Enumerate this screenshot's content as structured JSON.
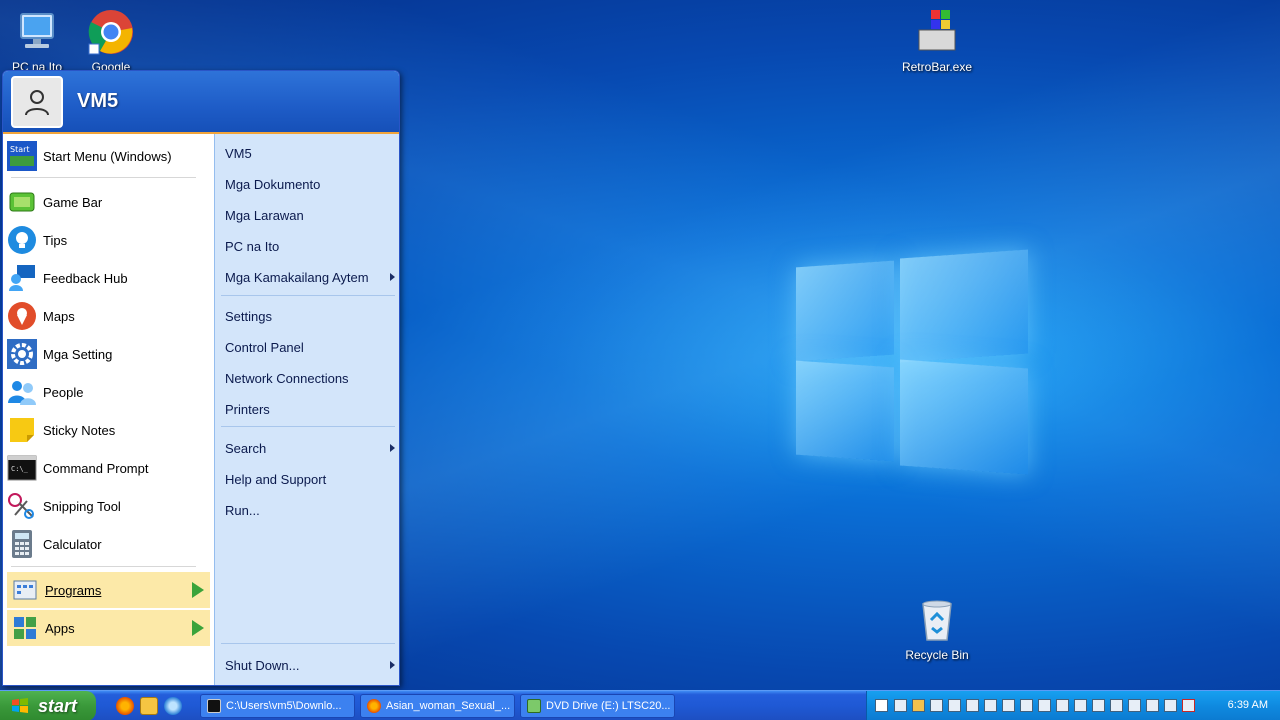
{
  "desktop": {
    "icons": [
      {
        "label": "PC na Ito",
        "icon": "computer-icon"
      },
      {
        "label": "Google",
        "icon": "chrome-icon"
      },
      {
        "label": "RetroBar.exe",
        "icon": "retrobar-icon"
      },
      {
        "label": "Recycle Bin",
        "icon": "recycle-bin-icon"
      }
    ]
  },
  "start_menu": {
    "user": "VM5",
    "left_items": [
      {
        "label": "Start Menu (Windows)",
        "icon": "start-menu-icon"
      },
      {
        "label": "Game Bar",
        "icon": "game-bar-icon"
      },
      {
        "label": "Tips",
        "icon": "tips-icon"
      },
      {
        "label": "Feedback Hub",
        "icon": "feedback-icon"
      },
      {
        "label": "Maps",
        "icon": "maps-icon"
      },
      {
        "label": "Mga Setting",
        "icon": "gear-icon"
      },
      {
        "label": "People",
        "icon": "people-icon"
      },
      {
        "label": "Sticky Notes",
        "icon": "sticky-notes-icon"
      },
      {
        "label": "Command Prompt",
        "icon": "cmd-icon"
      },
      {
        "label": "Snipping Tool",
        "icon": "scissors-icon"
      },
      {
        "label": "Calculator",
        "icon": "calculator-icon"
      }
    ],
    "programs_label": "Programs",
    "apps_label": "Apps",
    "search_placeholder": "Search",
    "right_items": [
      {
        "label": "VM5"
      },
      {
        "label": "Mga Dokumento"
      },
      {
        "label": "Mga Larawan"
      },
      {
        "label": "PC na Ito"
      },
      {
        "label": "Mga Kamakailang Aytem",
        "submenu": true
      },
      {
        "label": "Settings"
      },
      {
        "label": "Control Panel"
      },
      {
        "label": "Network Connections"
      },
      {
        "label": "Printers"
      },
      {
        "label": "Search",
        "submenu": true
      },
      {
        "label": "Help and Support"
      },
      {
        "label": "Run..."
      }
    ],
    "shutdown_label": "Shut Down..."
  },
  "taskbar": {
    "start_label": "start",
    "tasks": [
      {
        "label": "C:\\Users\\vm5\\Downlo...",
        "icon": "cmd-icon"
      },
      {
        "label": "Asian_woman_Sexual_...",
        "icon": "firefox-icon"
      },
      {
        "label": "DVD Drive (E:) LTSC20...",
        "icon": "dvd-drive-icon"
      }
    ],
    "clock": "6:39 AM"
  },
  "colors": {
    "taskbar_blue": "#245edb",
    "start_green": "#3a993a",
    "menu_header": "#1e5cc7",
    "menu_right_bg": "#d3e5fa",
    "programs_bg": "#fce9a8"
  }
}
